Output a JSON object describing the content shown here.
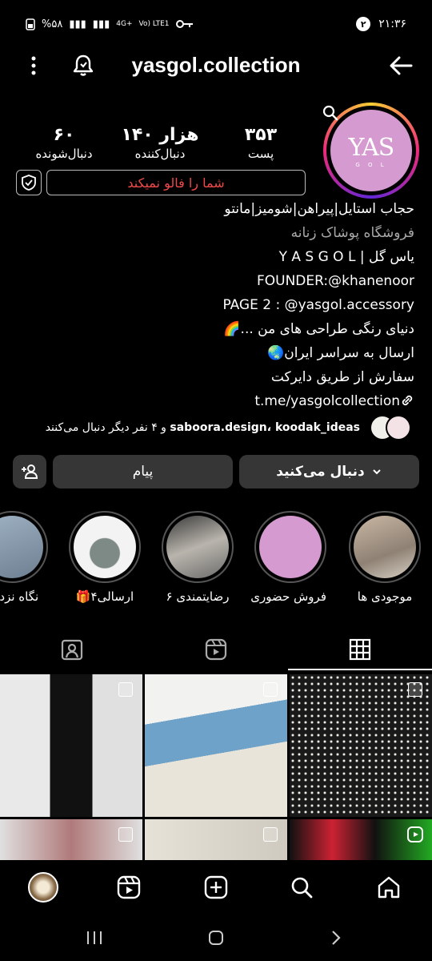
{
  "status_bar": {
    "time": "۲۱:۳۶",
    "notification_count": "۲",
    "battery": "%۵۸",
    "network": "4G+",
    "volte": "Vo) LTE1"
  },
  "header": {
    "username": "yasgol.collection"
  },
  "avatar": {
    "logo_text": "YAS",
    "logo_sub": "G O L"
  },
  "stats": {
    "posts_count": "۳۵۳",
    "posts_label": "پست",
    "followers_count": "۱۴۰ هزار",
    "followers_label": "دنبال‌کننده",
    "following_count": "۶۰",
    "following_label": "دنبال‌شونده"
  },
  "not_following_label": "شما را فالو نمیکند",
  "bio": {
    "name": "حجاب استایل|پیراهن|شومیز|مانتو",
    "category": "فروشگاه پوشاک زنانه",
    "line1": "یاس گل | Y A S G O L",
    "line2": "FOUNDER:@khanenoor",
    "line3": "PAGE 2 : @yasgol.accessory",
    "line4": "دنیای رنگی طراحی های من ...🌈",
    "line5": "ارسال به سراسر ایران🌏",
    "line6": "سفارش از طریق دایرکت",
    "link": "t.me/yasgolcollection"
  },
  "followed_by": {
    "users": "saboora.design، koodak_ideas",
    "suffix": "و ۴ نفر دیگر دنبال می‌کنند"
  },
  "buttons": {
    "following_label": "دنبال می‌کنید",
    "message_label": "پیام"
  },
  "highlights": [
    {
      "label": "موجودی ها"
    },
    {
      "label": "فروش حضوری"
    },
    {
      "label": "رضایتمندی ۶"
    },
    {
      "label": "ارسالی۴🎁"
    },
    {
      "label": "نگاه نزدیک"
    }
  ],
  "tabs": [
    "grid",
    "reels",
    "tagged"
  ],
  "colors": {
    "accent_red": "#ef4a4a",
    "button_bg": "#363636",
    "avatar_pink": "#d59ad0"
  }
}
